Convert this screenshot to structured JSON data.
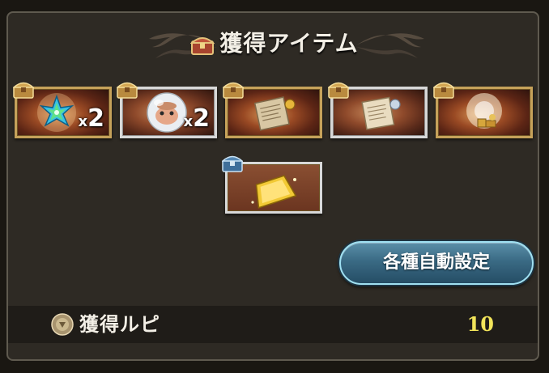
{
  "header": {
    "title": "獲得アイテム",
    "title_icon": "treasure-chest-icon"
  },
  "items": [
    {
      "name": "crystal-gem",
      "count_x": "x",
      "count_n": "2",
      "frame": "gold",
      "chest": "gold-chest"
    },
    {
      "name": "orb-pet",
      "count_x": "x",
      "count_n": "2",
      "frame": "silver",
      "chest": "gold-chest"
    },
    {
      "name": "scroll-gold-seal",
      "count_x": "",
      "count_n": "",
      "frame": "gold",
      "chest": "gold-chest"
    },
    {
      "name": "scroll-silver-seal",
      "count_x": "",
      "count_n": "",
      "frame": "silver",
      "chest": "gold-chest"
    },
    {
      "name": "treasure-pile",
      "count_x": "",
      "count_n": "",
      "frame": "gold",
      "chest": "gold-chest"
    },
    {
      "name": "gold-bar",
      "count_x": "",
      "count_n": "",
      "frame": "silver",
      "chest": "blue-chest"
    }
  ],
  "auto_settings_button": {
    "label": "各種自動設定"
  },
  "rupie": {
    "label": "獲得ルピ",
    "value": "10",
    "icon": "rupie-coin-icon"
  },
  "colors": {
    "panel_bg": "#2e2a24",
    "gold_frame": "#c6a25a",
    "silver_frame": "#d8d8d8",
    "button_blue": "#3a6a84",
    "rupie_value": "#f2e45a"
  }
}
